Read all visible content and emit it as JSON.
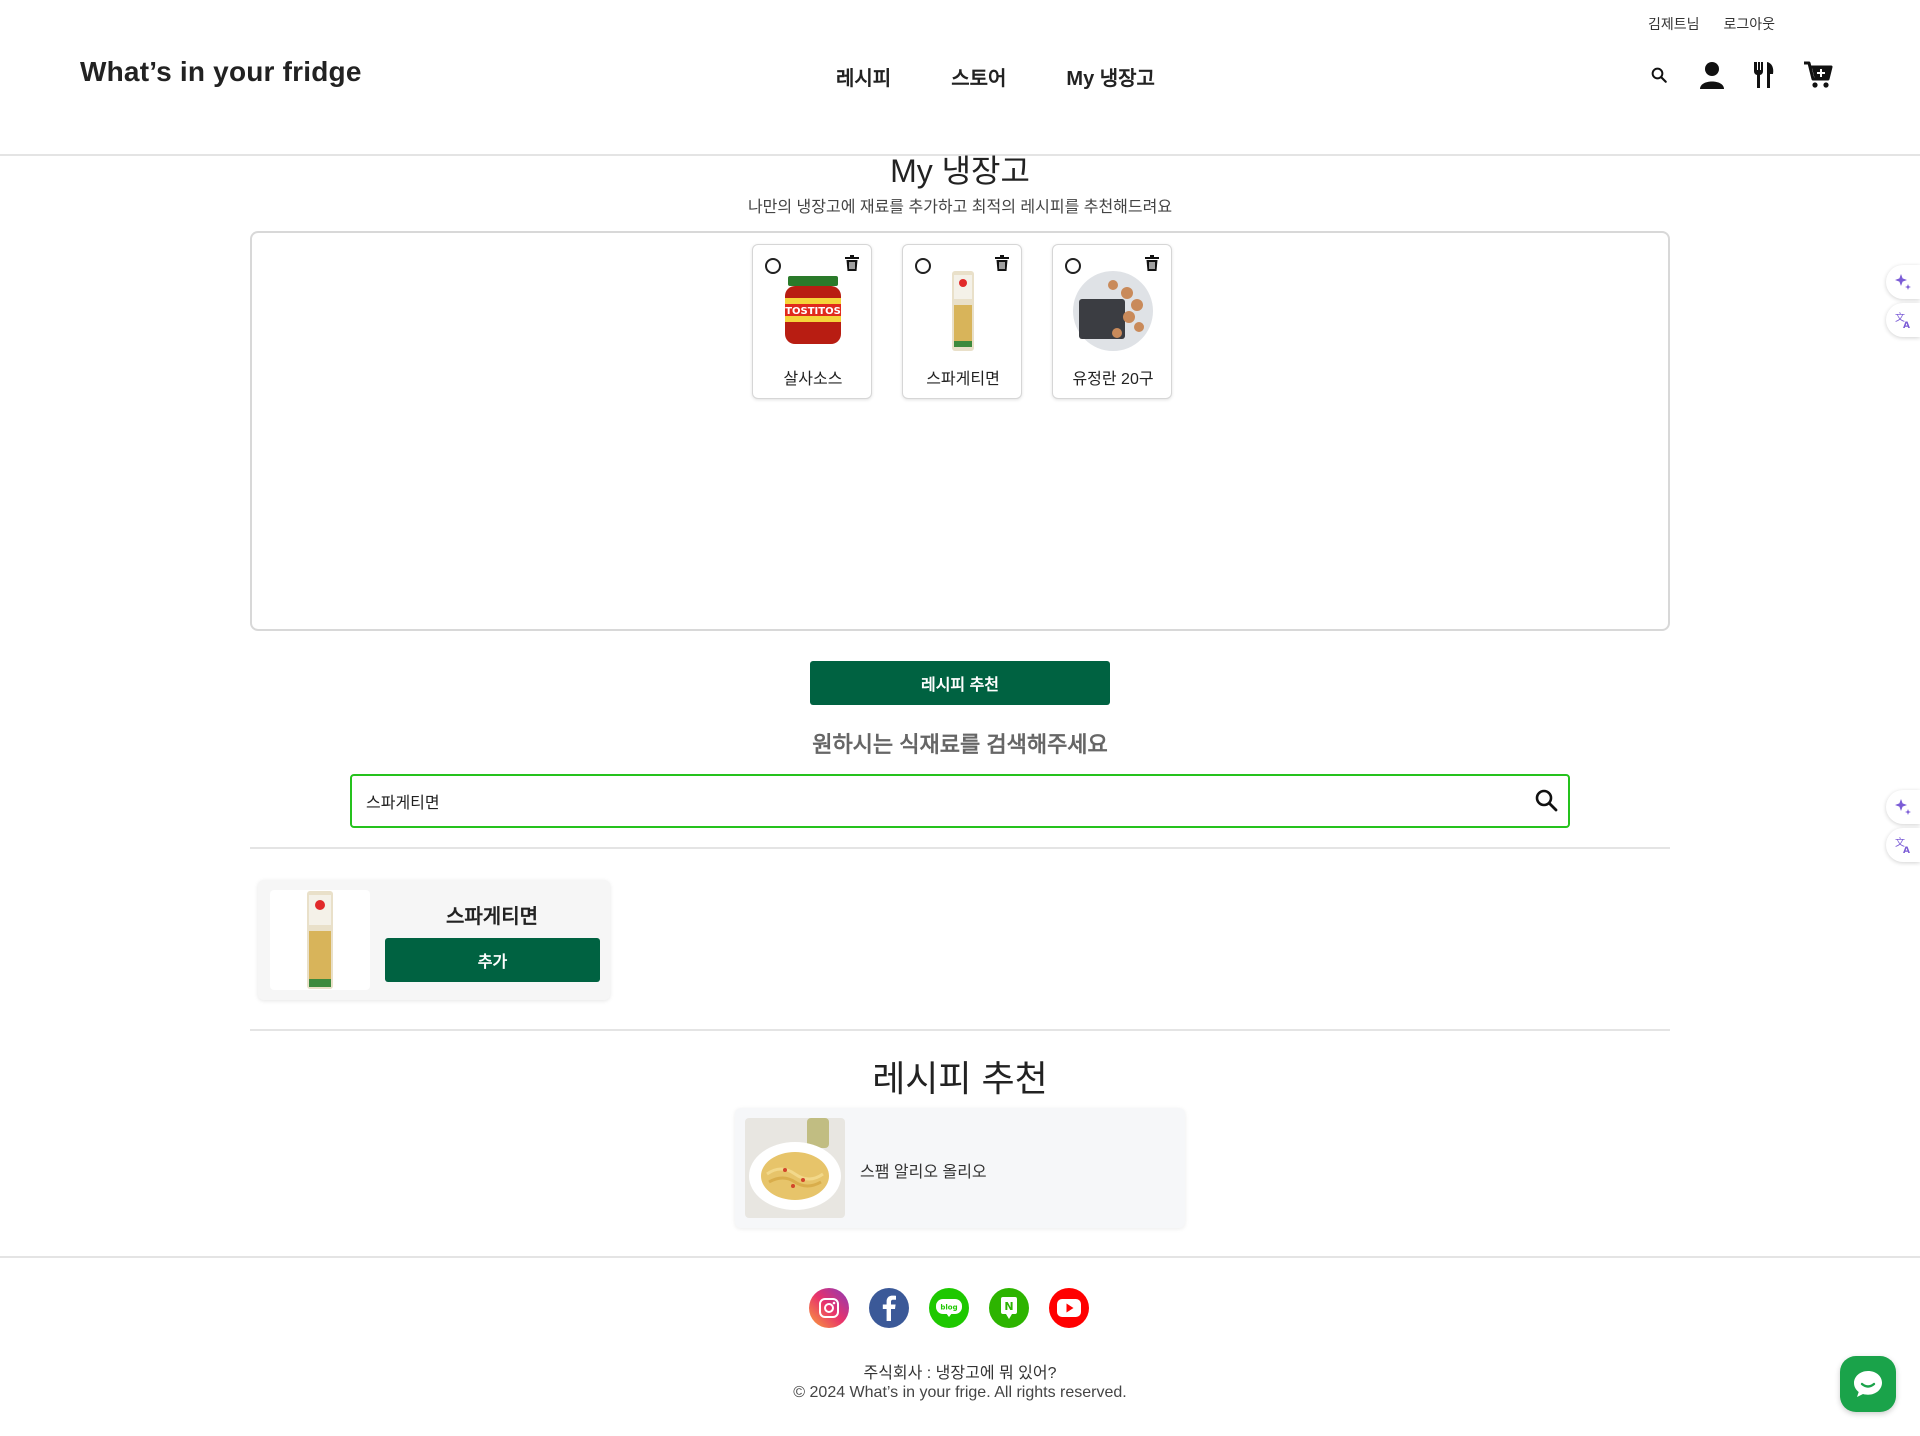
{
  "header": {
    "brand": "What’s in your fridge",
    "user_name": "김제트님",
    "logout": "로그아웃",
    "nav": [
      "레시피",
      "스토어",
      "My 냉장고"
    ]
  },
  "fridge": {
    "title": "My 냉장고",
    "subtitle": "나만의 냉장고에 재료를 추가하고 최적의 레시피를 추천해드려요",
    "items": [
      {
        "name": "살사소스"
      },
      {
        "name": "스파게티면"
      },
      {
        "name": "유정란 20구"
      }
    ],
    "recommend_button": "레시피 추천"
  },
  "search": {
    "title": "원하시는 식재료를 검색해주세요",
    "value": "스파게티면",
    "result": {
      "name": "스파게티면",
      "add_button": "추가"
    }
  },
  "recipes": {
    "title": "레시피 추천",
    "items": [
      {
        "name": "스팸 알리오 올리오"
      }
    ]
  },
  "footer": {
    "company": "주식회사 : 냉장고에 뭐 있어?",
    "copyright": "© 2024 What’s in your frige. All rights reserved.",
    "socials": [
      "instagram-icon",
      "facebook-icon",
      "blog-icon",
      "naver-post-icon",
      "youtube-icon"
    ]
  },
  "colors": {
    "primary": "#006241",
    "search_border": "#25c21d",
    "chat": "#1aa34a",
    "widget_purple": "#7b5cd6"
  }
}
